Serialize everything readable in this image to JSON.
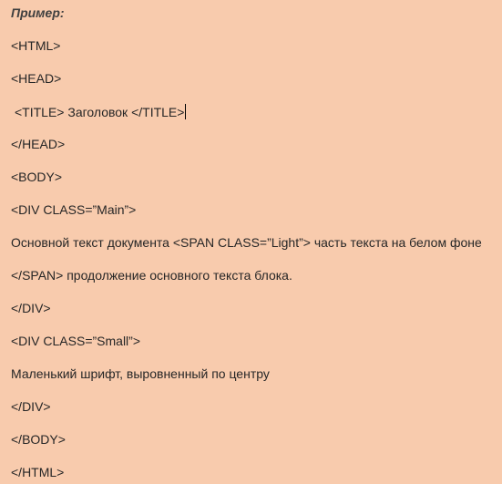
{
  "document": {
    "heading": "Пример:",
    "lines": [
      "<HTML>",
      "<HEAD>",
      "<TITLE> Заголовок </TITLE>",
      "</HEAD>",
      "<BODY>",
      "<DIV CLASS=”Main”>",
      "Основной текст документа <SPAN CLASS=”Light”> часть текста на белом фоне",
      "</SPAN> продолжение основного текста блока.",
      "</DIV>",
      "<DIV CLASS=”Small”>",
      "Маленький шрифт, выровненный по центру",
      "</DIV>",
      "</BODY>",
      "</HTML>"
    ]
  }
}
